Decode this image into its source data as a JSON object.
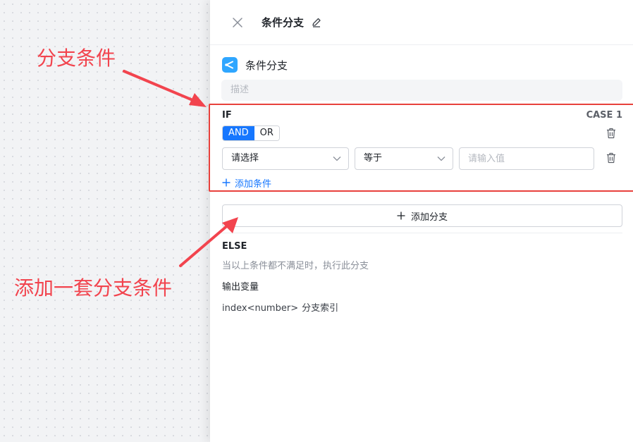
{
  "canvas": {
    "annotation_branch": "分支条件",
    "annotation_add": "添加一套分支条件",
    "annotation_color": "#f2444e"
  },
  "panel": {
    "header": {
      "title": "条件分支",
      "close_icon": "close-icon",
      "edit_icon": "edit-icon"
    },
    "node": {
      "title": "条件分支",
      "icon": "branch-icon",
      "icon_color": "#2fa6ff",
      "description_placeholder": "描述"
    },
    "case1": {
      "if_label": "IF",
      "case_label": "CASE 1",
      "logic": {
        "and": "AND",
        "or": "OR",
        "selected": "AND"
      },
      "condition": {
        "variable": "请选择",
        "operator": "等于",
        "value_placeholder": "请输入值"
      },
      "add_condition": "添加条件"
    },
    "add_branch": "添加分支",
    "else": {
      "label": "ELSE",
      "description": "当以上条件都不满足时，执行此分支"
    },
    "output": {
      "title": "输出变量",
      "var_name": "index<number>",
      "var_desc": "分支索引"
    },
    "accent_color": "#1677ff",
    "highlight_color": "#e8413c"
  }
}
